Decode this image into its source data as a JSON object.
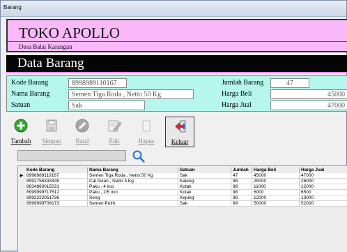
{
  "window": {
    "title": "Barang"
  },
  "header": {
    "store_name": "TOKO APOLLO",
    "address": "Desa Balai Karangan",
    "section_title": "Data Barang"
  },
  "form": {
    "kode_label": "Kode Barang",
    "kode_value": "8998989110167",
    "nama_label": "Nama Barang",
    "nama_value": "Semen Tiga Roda , Netto 50 Kg",
    "satuan_label": "Satuan",
    "satuan_value": "Sak",
    "jumlah_label": "Jumlah Barang",
    "jumlah_value": "47",
    "beli_label": "Harga Beli",
    "beli_value": "45000",
    "jual_label": "Harga Jual",
    "jual_value": "47000"
  },
  "toolbar": {
    "tambah": "Tambah",
    "simpan": "Simpan",
    "batal": "Batal",
    "edit": "Edit",
    "hapus": "Hapus",
    "keluar": "Keluar"
  },
  "table": {
    "columns": [
      "Kode Barang",
      "Nama Barang",
      "Satuan",
      "Jumlah",
      "Harga Beli",
      "Harga Jual"
    ],
    "current_row_marker": "▶",
    "rows": [
      [
        "8998989110167",
        "Semen Tiga Roda , Netto 50 Kg",
        "Sak",
        "47",
        "45000",
        "47000"
      ],
      [
        "8992756333445",
        "Cat Avian , Netto 5 Kg",
        "Kaleng",
        "98",
        "25000",
        "26000"
      ],
      [
        "8934860015031",
        "Paku , 4 inci",
        "Kotak",
        "98",
        "11000",
        "12000"
      ],
      [
        "8999999717612",
        "Paku , 2/5 inci",
        "Kotak",
        "98",
        "6000",
        "6500"
      ],
      [
        "8992222051736",
        "Seng",
        "Keping",
        "98",
        "12000",
        "13000"
      ],
      [
        "8999999706173",
        "Semen Putih",
        "Sak",
        "99",
        "50000",
        "52000"
      ]
    ]
  },
  "colors": {
    "banner": "#f9b9f9",
    "form_bg": "#b5f7ec",
    "title_bar": "#050505"
  }
}
